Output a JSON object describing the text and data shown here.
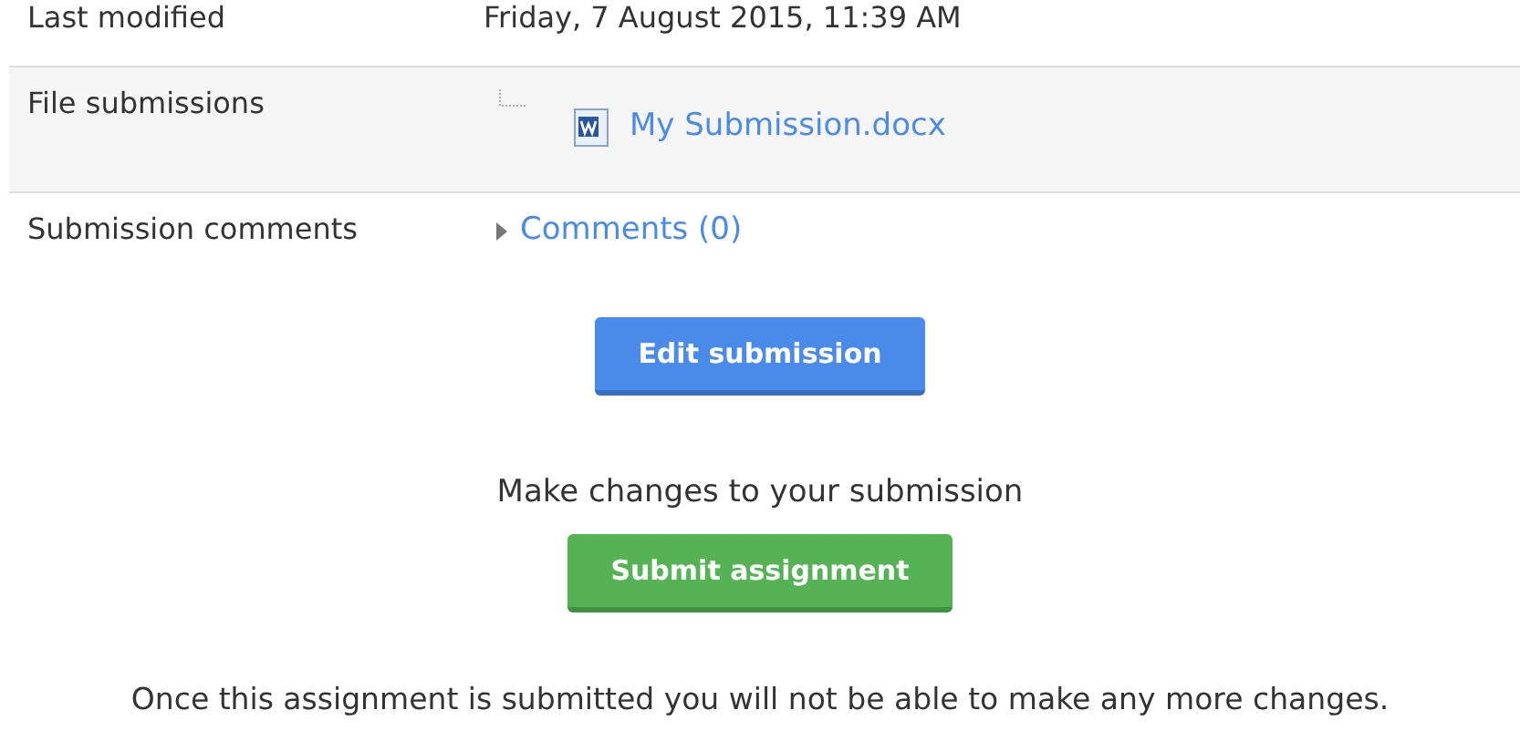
{
  "rows": [
    {
      "label": "Last modified",
      "kind": "text",
      "value": "Friday, 7 August 2015, 11:39 AM",
      "shaded": false
    },
    {
      "label": "File submissions",
      "kind": "file",
      "value": "My Submission.docx",
      "shaded": true
    },
    {
      "label": "Submission comments",
      "kind": "comments",
      "value": "Comments (0)",
      "expanded": false,
      "shaded": false
    }
  ],
  "edit_button": "Edit submission",
  "submit_hint": "Make changes to your submission",
  "submit_button": "Submit assignment",
  "notice": "Once this assignment is submitted you will not be able to make any more changes."
}
